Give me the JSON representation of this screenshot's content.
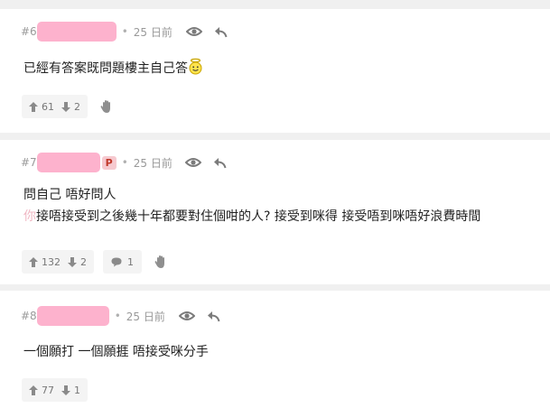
{
  "posts": [
    {
      "number": "#6",
      "time": "25 日前",
      "lines": [
        "已經有答案既問題樓主自己答"
      ],
      "has_emoji": true,
      "upvotes": "61",
      "downvotes": "2"
    },
    {
      "number": "#7",
      "poster_tag": "P",
      "time": "25 日前",
      "line1": "問自己 唔好問人",
      "quote_fade": "你",
      "quote_rest": "接唔接受到之後幾十年都要對住個咁的人? 接受到咪得 接受唔到咪唔好浪費時間",
      "upvotes": "132",
      "downvotes": "2",
      "replies": "1"
    },
    {
      "number": "#8",
      "time": "25 日前",
      "lines": [
        "一個願打 一個願捱 唔接受咪分手"
      ],
      "upvotes": "77",
      "downvotes": "1"
    }
  ],
  "colors": {
    "background": "#f0f0f0",
    "card": "#ffffff",
    "redacted_name": "#fdb2cd",
    "poster_badge": "#f6c9cf"
  },
  "icons": [
    "eye-icon",
    "reply-icon",
    "thumbs-up-arrow-icon",
    "thumbs-down-arrow-icon",
    "comment-icon",
    "hand-icon",
    "angel-emoji-icon"
  ]
}
